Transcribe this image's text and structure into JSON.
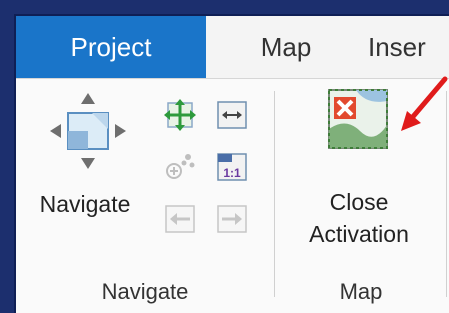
{
  "tabs": [
    {
      "label": "Project",
      "active": true
    },
    {
      "label": "Map",
      "active": false
    },
    {
      "label": "Inser",
      "active": false
    }
  ],
  "groups": {
    "navigate": {
      "label": "Navigate",
      "large_button": {
        "label": "Navigate",
        "icon": "navigate-icon"
      },
      "small_buttons": [
        {
          "icon": "full-extent-icon",
          "enabled": true
        },
        {
          "icon": "fixed-zoom-icon",
          "enabled": true
        },
        {
          "icon": "zoom-to-selected-icon",
          "enabled": false
        },
        {
          "icon": "scale-1-1-icon",
          "enabled": true
        },
        {
          "icon": "previous-extent-icon",
          "enabled": false
        },
        {
          "icon": "next-extent-icon",
          "enabled": false
        }
      ]
    },
    "map": {
      "label": "Map",
      "close_activation": {
        "label_line1": "Close",
        "label_line2": "Activation",
        "icon": "close-activation-icon"
      }
    }
  },
  "annotation": {
    "color": "#e01b1b",
    "icon": "red-arrow-pointer"
  },
  "colors": {
    "active_tab": "#1a75c9",
    "background": "#1c2f6e"
  }
}
